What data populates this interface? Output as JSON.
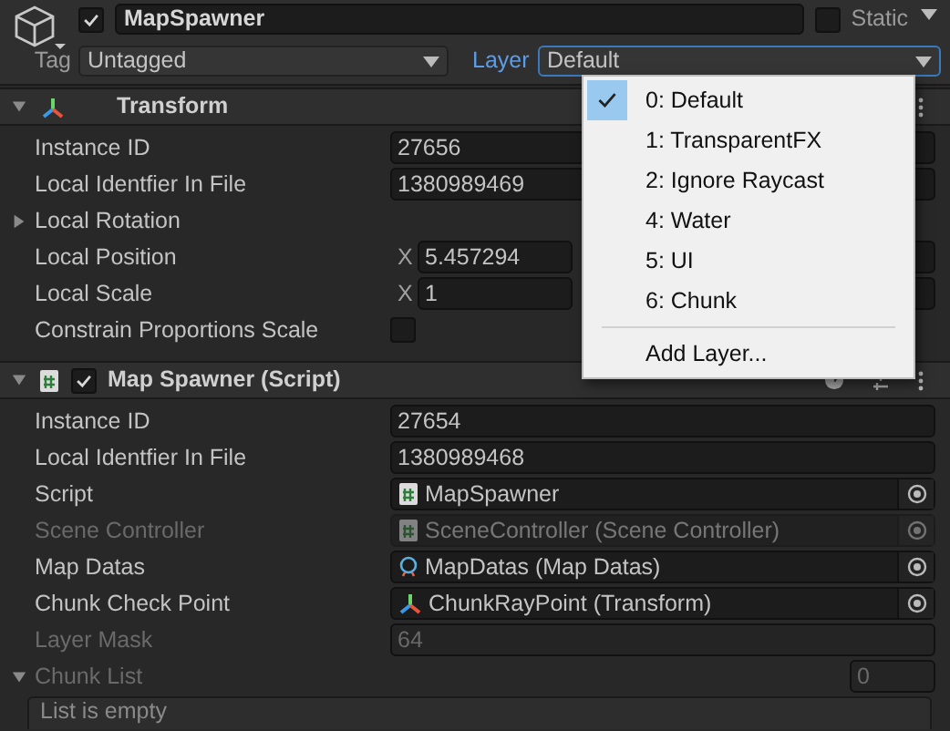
{
  "game_object": {
    "active": true,
    "name": "MapSpawner",
    "static": {
      "label": "Static",
      "checked": false
    },
    "tag": {
      "label": "Tag",
      "value": "Untagged"
    },
    "layer": {
      "label": "Layer",
      "value": "Default",
      "open": true
    }
  },
  "components": [
    {
      "name": "Transform",
      "kind": "transform",
      "expanded": true,
      "rows": [
        {
          "kind": "field",
          "label": "Instance ID",
          "value": "27656",
          "disabled": false
        },
        {
          "kind": "field",
          "label": "Local Identfier In File",
          "value": "1380989469",
          "disabled": false
        },
        {
          "kind": "foldout",
          "label": "Local Rotation",
          "expanded": false
        },
        {
          "kind": "vector",
          "label": "Local Position",
          "axis": "X",
          "value": "5.457294"
        },
        {
          "kind": "vector",
          "label": "Local Scale",
          "axis": "X",
          "value": "1"
        },
        {
          "kind": "checkbox",
          "label": "Constrain Proportions Scale",
          "checked": false
        }
      ]
    },
    {
      "name": "Map Spawner (Script)",
      "kind": "script",
      "expanded": true,
      "enabled": true,
      "rows": [
        {
          "kind": "field",
          "label": "Instance ID",
          "value": "27654",
          "disabled": false
        },
        {
          "kind": "field",
          "label": "Local Identfier In File",
          "value": "1380989468",
          "disabled": false
        },
        {
          "kind": "script_ref",
          "label": "Script",
          "value": "MapSpawner",
          "disabled": false
        },
        {
          "kind": "script_ref",
          "label": "Scene Controller",
          "value": "SceneController (Scene Controller)",
          "disabled": true
        },
        {
          "kind": "asset_ref",
          "label": "Map Datas",
          "value": "MapDatas (Map Datas)",
          "disabled": false
        },
        {
          "kind": "transform_ref",
          "label": "Chunk Check Point",
          "value": "ChunkRayPoint (Transform)",
          "disabled": false
        },
        {
          "kind": "field",
          "label": "Layer Mask",
          "value": "64",
          "disabled": true
        },
        {
          "kind": "list",
          "label": "Chunk List",
          "expanded": true,
          "count": "0",
          "note": "List is empty"
        }
      ]
    }
  ],
  "layer_menu": {
    "items": [
      {
        "label": "0: Default",
        "selected": true
      },
      {
        "label": "1: TransparentFX",
        "selected": false
      },
      {
        "label": "2: Ignore Raycast",
        "selected": false
      },
      {
        "label": "4: Water",
        "selected": false
      },
      {
        "label": "5: UI",
        "selected": false
      },
      {
        "label": "6: Chunk",
        "selected": false
      }
    ],
    "action": "Add Layer..."
  }
}
